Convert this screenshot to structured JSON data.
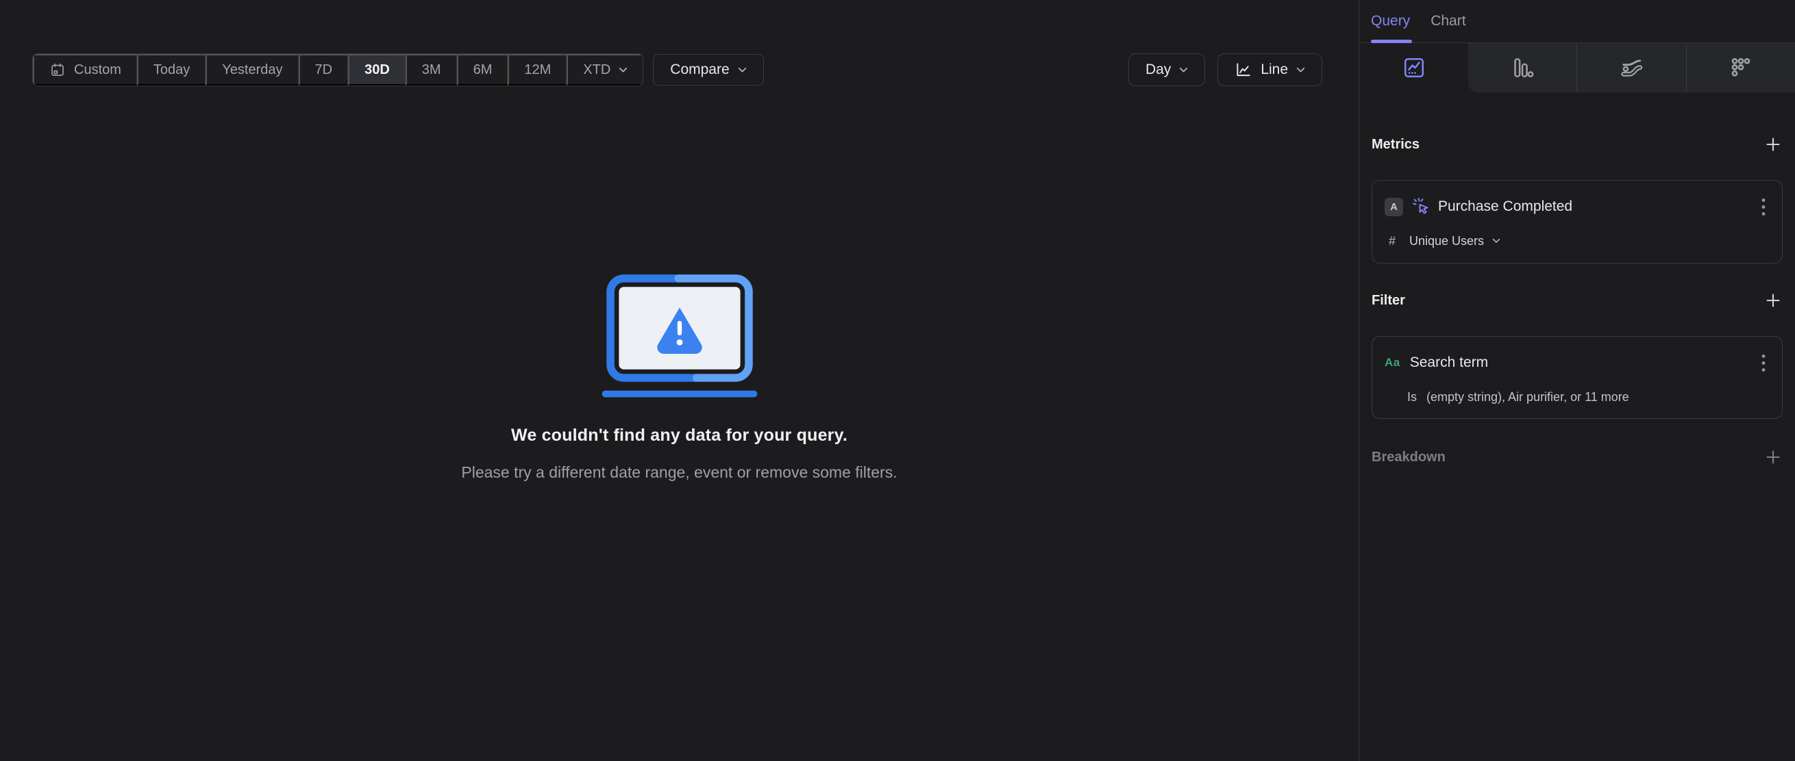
{
  "colors": {
    "accent": "#8285f4",
    "illustration_blue": "#2f7ae6",
    "illustration_blue_light": "#62a2f5",
    "filter_green": "#3fa374",
    "background": "#1c1c1e"
  },
  "toolbar": {
    "ranges": [
      {
        "label": "Custom"
      },
      {
        "label": "Today"
      },
      {
        "label": "Yesterday"
      },
      {
        "label": "7D"
      },
      {
        "label": "30D",
        "selected": true
      },
      {
        "label": "3M"
      },
      {
        "label": "6M"
      },
      {
        "label": "12M"
      },
      {
        "label": "XTD",
        "has_dropdown": true
      }
    ],
    "compare_label": "Compare",
    "granularity_label": "Day",
    "chart_type_label": "Line"
  },
  "empty_state": {
    "title": "We couldn't find any data for your query.",
    "subtitle": "Please try a different date range, event or remove some filters."
  },
  "sidebar": {
    "tabs": [
      {
        "label": "Query",
        "active": true
      },
      {
        "label": "Chart",
        "active": false
      }
    ],
    "icon_tabs": [
      "insights",
      "funnels",
      "flows",
      "retention"
    ],
    "metrics": {
      "heading": "Metrics",
      "items": [
        {
          "letter": "A",
          "event_icon": "cursor-click-icon",
          "name": "Purchase Completed",
          "aggregation_symbol": "#",
          "aggregation": "Unique Users"
        }
      ]
    },
    "filter": {
      "heading": "Filter",
      "items": [
        {
          "type_icon": "Aa",
          "name": "Search term",
          "operator": "Is",
          "value": "(empty string), Air purifier, or 11 more"
        }
      ]
    },
    "breakdown": {
      "heading": "Breakdown"
    }
  }
}
